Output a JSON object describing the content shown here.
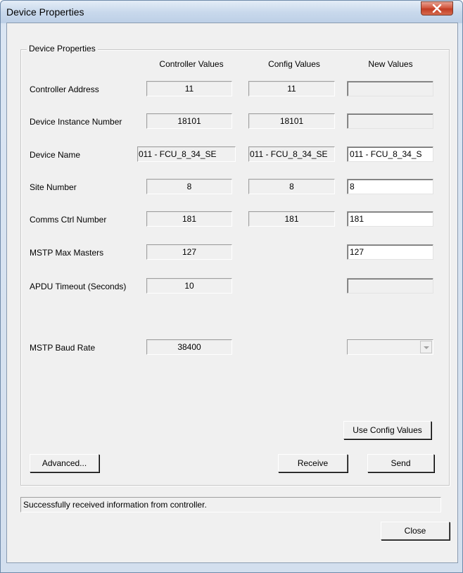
{
  "window": {
    "title": "Device Properties"
  },
  "group": {
    "legend": "Device Properties"
  },
  "columns": {
    "controller": "Controller Values",
    "config": "Config Values",
    "new": "New Values"
  },
  "rows": [
    {
      "label": "Controller Address",
      "controller": "11",
      "config": "11",
      "new": ""
    },
    {
      "label": "Device Instance Number",
      "controller": "18101",
      "config": "18101",
      "new": ""
    },
    {
      "label": "Device Name",
      "controller": "011 - FCU_8_34_SE",
      "config": "011 - FCU_8_34_SE",
      "new": "011 - FCU_8_34_S"
    },
    {
      "label": "Site Number",
      "controller": "8",
      "config": "8",
      "new": "8"
    },
    {
      "label": "Comms Ctrl Number",
      "controller": "181",
      "config": "181",
      "new": "181"
    },
    {
      "label": "MSTP Max Masters",
      "controller": "127",
      "new": "127"
    },
    {
      "label": "APDU Timeout (Seconds)",
      "controller": "10",
      "new": ""
    },
    {
      "label": "MSTP Baud Rate",
      "controller": "38400",
      "new": ""
    }
  ],
  "buttons": {
    "use_config": "Use Config Values",
    "advanced": "Advanced...",
    "receive": "Receive",
    "send": "Send",
    "close": "Close"
  },
  "status": "Successfully received information from controller.",
  "colors": {
    "title_close": "#c13b22",
    "client_bg": "#f0f0f0"
  }
}
